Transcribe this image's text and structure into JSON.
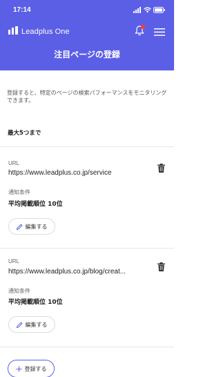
{
  "status_bar": {
    "time": "17:14"
  },
  "header": {
    "brand": "Leadplus One",
    "title": "注目ページの登録"
  },
  "intro": {
    "description": "登録すると、特定のページの検索パフォーマンスをモニタリングできます。",
    "limit": "最大5つまで"
  },
  "pages": [
    {
      "url_label": "URL",
      "url": "https://www.leadplus.co.jp/service",
      "condition_label": "通知条件",
      "condition": "平均掲載順位 10位",
      "edit_label": "編集する"
    },
    {
      "url_label": "URL",
      "url": "https://www.leadplus.co.jp/blog/creat...",
      "condition_label": "通知条件",
      "condition": "平均掲載順位 10位",
      "edit_label": "編集する"
    }
  ],
  "register_label": "登録する",
  "colors": {
    "brand": "#5b5fe6",
    "notification_dot": "#ff3b30"
  },
  "icons": [
    "signal-icon",
    "wifi-icon",
    "battery-icon",
    "logo-icon",
    "bell-icon",
    "menu-icon",
    "trash-icon",
    "pencil-icon",
    "plus-icon"
  ]
}
